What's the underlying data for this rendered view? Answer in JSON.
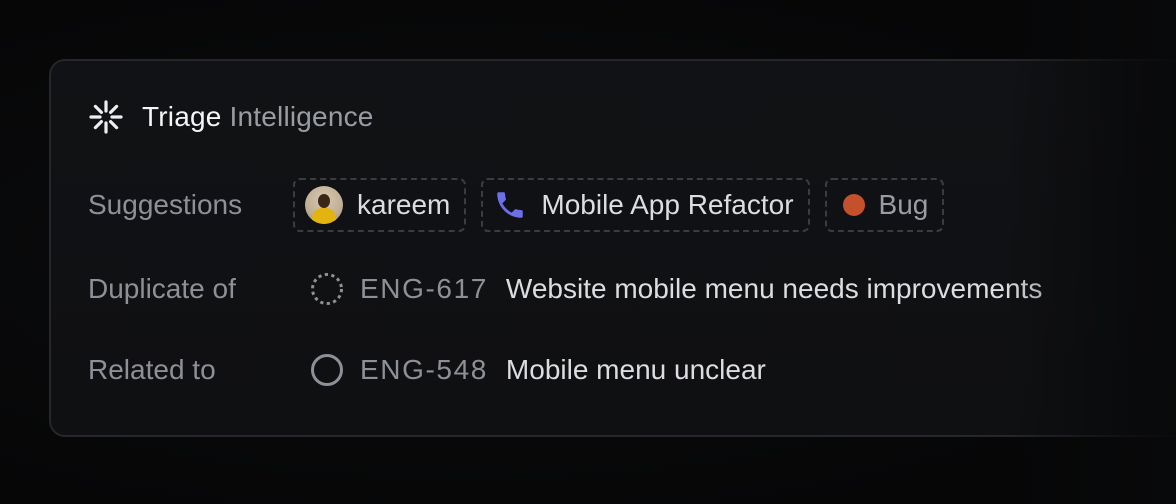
{
  "header": {
    "title_part1": "Triage",
    "title_part2": "Intelligence",
    "icon": "sparkle-icon"
  },
  "suggestions": {
    "label": "Suggestions",
    "assignee": {
      "name": "kareem",
      "icon": "avatar"
    },
    "project": {
      "name": "Mobile App Refactor",
      "icon": "phone-icon",
      "color": "#6e6ee6"
    },
    "label_chip": {
      "name": "Bug",
      "icon": "dot-icon",
      "color": "#c4512b"
    }
  },
  "duplicate": {
    "label": "Duplicate of",
    "issue_id": "ENG-617",
    "issue_title": "Website mobile menu needs improvements",
    "status_icon": "dashed-circle-icon"
  },
  "related": {
    "label": "Related to",
    "issue_id": "ENG-548",
    "issue_title": "Mobile menu unclear",
    "status_icon": "circle-icon"
  }
}
